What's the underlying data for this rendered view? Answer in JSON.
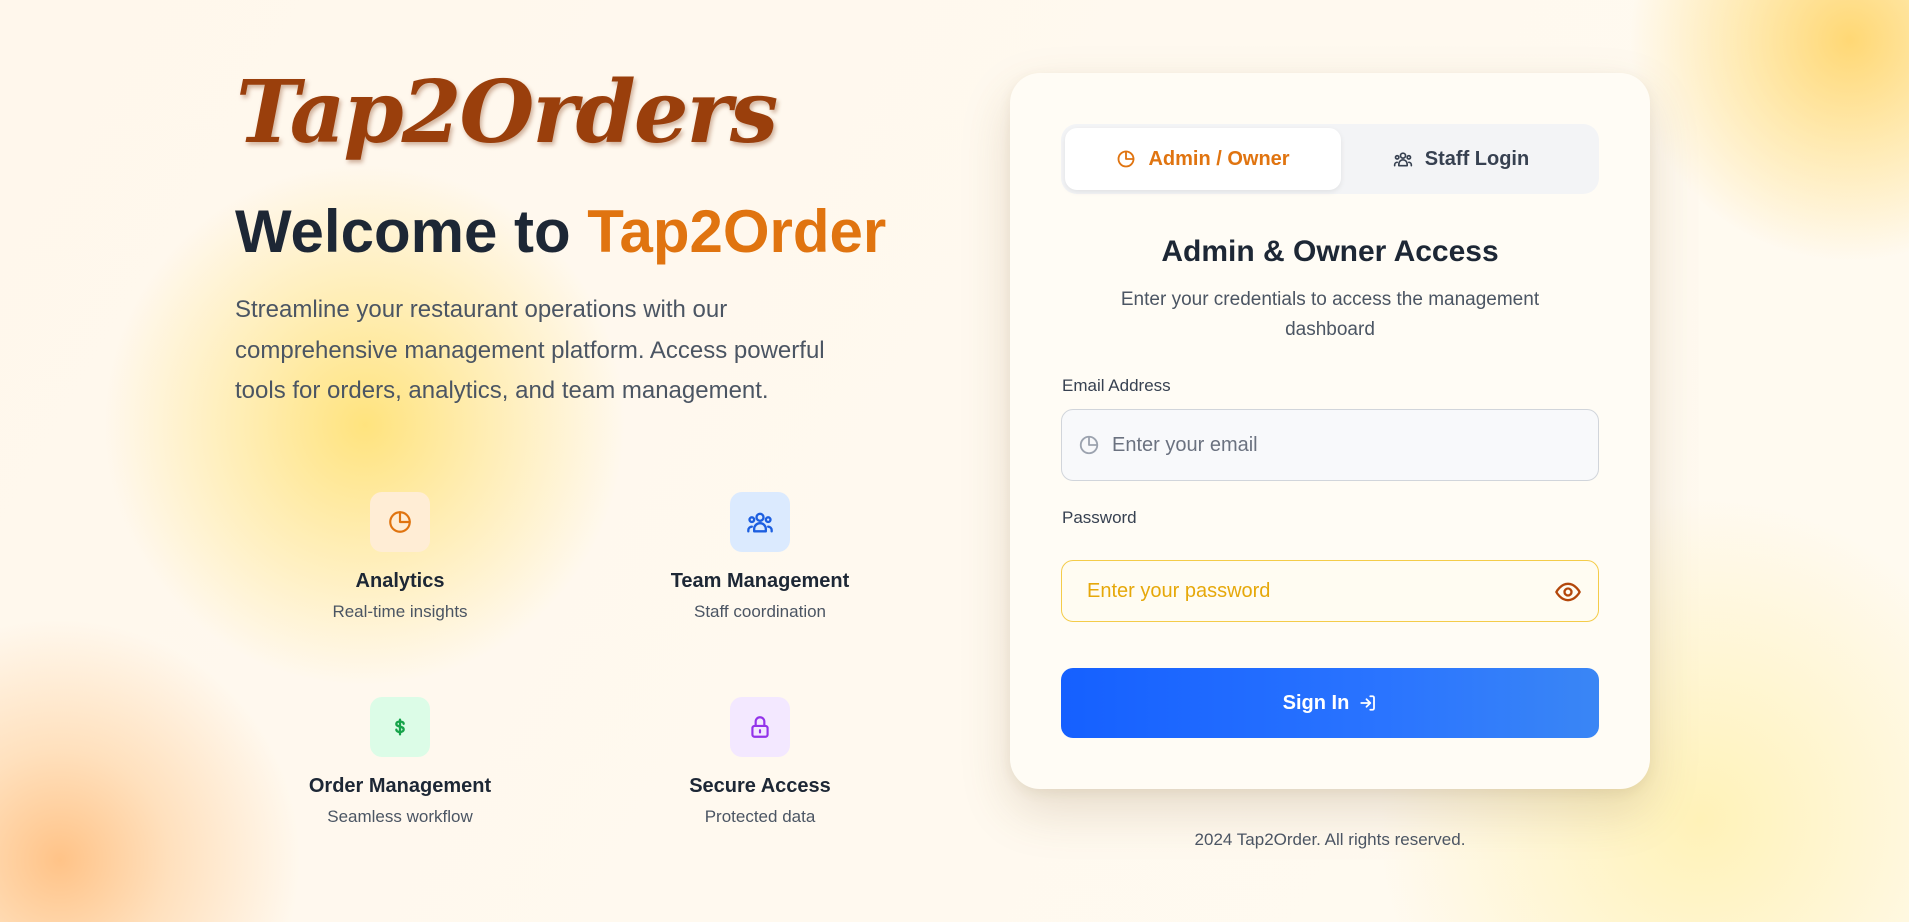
{
  "brand": {
    "logo_text": "Tap2Orders"
  },
  "hero": {
    "welcome_prefix": "Welcome to ",
    "welcome_accent": "Tap2Order",
    "description": "Streamline your restaurant operations with our comprehensive management platform. Access powerful tools for orders, analytics, and team management."
  },
  "features": [
    {
      "icon": "analytics-icon",
      "title": "Analytics",
      "subtitle": "Real-time insights"
    },
    {
      "icon": "team-icon",
      "title": "Team Management",
      "subtitle": "Staff coordination"
    },
    {
      "icon": "dollar-icon",
      "title": "Order Management",
      "subtitle": "Seamless workflow"
    },
    {
      "icon": "lock-icon",
      "title": "Secure Access",
      "subtitle": "Protected data"
    }
  ],
  "login": {
    "tabs": [
      {
        "label": "Admin / Owner",
        "icon": "analytics-icon",
        "active": true
      },
      {
        "label": "Staff Login",
        "icon": "team-icon",
        "active": false
      }
    ],
    "title": "Admin & Owner Access",
    "subtitle": "Enter your credentials to access the management dashboard",
    "email_label": "Email Address",
    "email_placeholder": "Enter your email",
    "password_label": "Password",
    "password_placeholder": "Enter your password",
    "signin_label": "Sign In"
  },
  "footer": {
    "copyright": "2024 Tap2Order. All rights reserved."
  },
  "colors": {
    "accent_orange": "#e07410",
    "brand_brown": "#9a3f0c",
    "primary_blue": "#1560ff",
    "dark_text": "#1d2735"
  }
}
